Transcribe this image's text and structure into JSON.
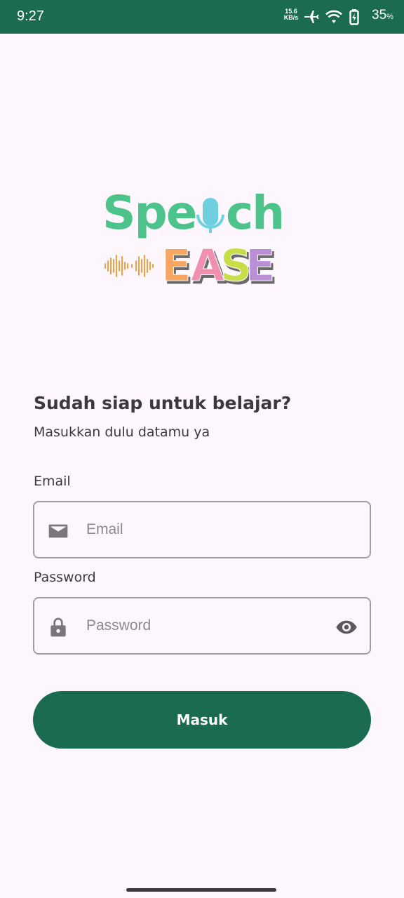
{
  "status_bar": {
    "time": "9:27",
    "net_speed_value": "15.6",
    "net_speed_unit": "KB/s",
    "battery_percent": "35",
    "battery_unit": "%",
    "icons": [
      "airplane-icon",
      "wifi-icon",
      "battery-icon"
    ]
  },
  "logo": {
    "word_top": "Speech",
    "word_bottom": "EASE",
    "colors": {
      "speech": "#4cc38a",
      "mic": "#6dcfe0",
      "e1": "#f7a560",
      "a": "#f08fb0",
      "s": "#c8de4a",
      "e2": "#b98fd6",
      "wave": "#f0a040"
    }
  },
  "login": {
    "heading": "Sudah siap untuk belajar?",
    "subheading": "Masukkan dulu datamu ya",
    "email_label": "Email",
    "email_placeholder": "Email",
    "password_label": "Password",
    "password_placeholder": "Password",
    "submit_label": "Masuk"
  },
  "theme": {
    "primary": "#1b6b50",
    "background": "#fdf7fd",
    "text": "#3a3a3d",
    "border": "#a39ca5"
  }
}
